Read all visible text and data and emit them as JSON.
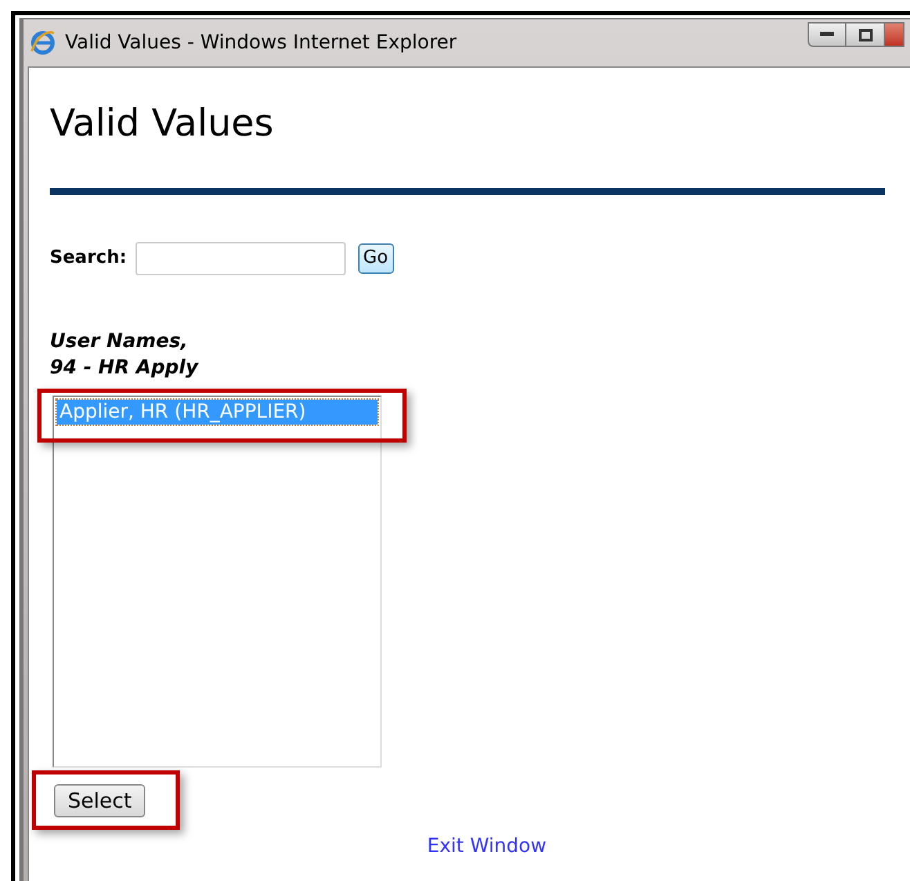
{
  "window": {
    "title": "Valid Values - Windows Internet Explorer"
  },
  "heading": "Valid Values",
  "search": {
    "label": "Search:",
    "button": "Go"
  },
  "list": {
    "label_lines": [
      "User Names,",
      "94 - HR Apply"
    ],
    "items": [
      {
        "text": "Applier, HR (HR_APPLIER)",
        "selected": true
      }
    ]
  },
  "select_button": {
    "label": "Select",
    "highlighted": true
  },
  "exit_link": "Exit Window"
}
